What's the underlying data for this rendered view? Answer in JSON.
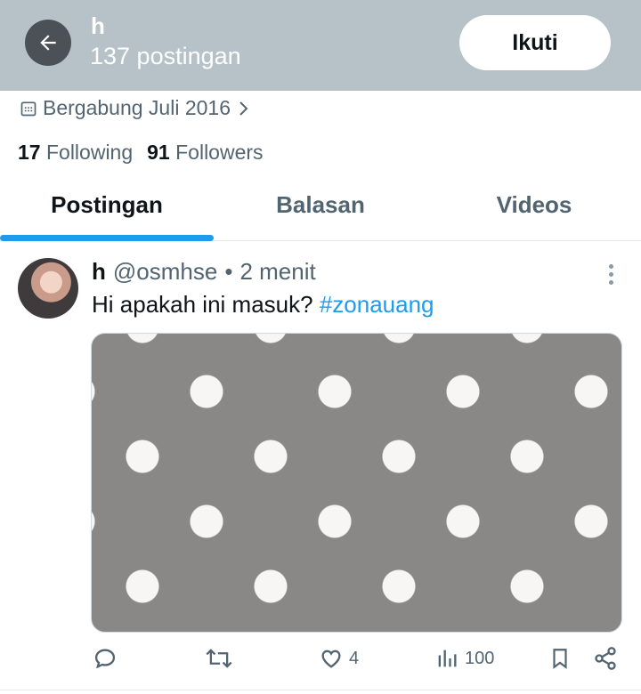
{
  "header": {
    "name": "h",
    "post_count": "137 postingan",
    "follow_label": "Ikuti"
  },
  "profile": {
    "joined": "Bergabung Juli 2016",
    "following_count": "17",
    "following_label": "Following",
    "followers_count": "91",
    "followers_label": "Followers"
  },
  "tabs": [
    {
      "label": "Postingan",
      "active": true
    },
    {
      "label": "Balasan",
      "active": false
    },
    {
      "label": "Videos",
      "active": false
    }
  ],
  "post": {
    "author": "h",
    "handle": "@osmhse",
    "separator": "•",
    "time": "2 menit",
    "text": "Hi apakah ini masuk?",
    "hashtag": "#zonauang",
    "media": {
      "pattern": "white polka dots on gray"
    },
    "likes": "4",
    "views": "100"
  },
  "colors": {
    "accent": "#1d9bf0",
    "header_bg": "#b6c1c8",
    "secondary_text": "#536471"
  }
}
